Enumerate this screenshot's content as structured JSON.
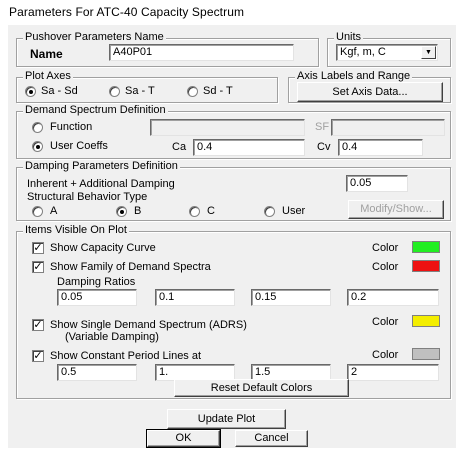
{
  "window_title": "Parameters For ATC-40 Capacity Spectrum",
  "pushover": {
    "legend": "Pushover Parameters Name",
    "name_label": "Name",
    "name_value": "A40P01"
  },
  "units": {
    "legend": "Units",
    "value": "Kgf, m, C"
  },
  "plot_axes": {
    "legend": "Plot Axes",
    "options": [
      "Sa - Sd",
      "Sa - T",
      "Sd - T"
    ],
    "selected": "Sa - Sd"
  },
  "axis_labels": {
    "legend": "Axis Labels and Range",
    "button": "Set Axis Data..."
  },
  "demand": {
    "legend": "Demand Spectrum Definition",
    "function_label": "Function",
    "user_coeffs_label": "User Coeffs",
    "sf_label": "SF",
    "ca_label": "Ca",
    "ca_value": "0.4",
    "cv_label": "Cv",
    "cv_value": "0.4",
    "selected": "User Coeffs"
  },
  "damping": {
    "legend": "Damping Parameters Definition",
    "inherent_label": "Inherent + Additional Damping",
    "inherent_value": "0.05",
    "behavior_label": "Structural Behavior Type",
    "types": [
      "A",
      "B",
      "C",
      "User"
    ],
    "selected": "B",
    "modify_button": "Modify/Show..."
  },
  "items": {
    "legend": "Items Visible On Plot",
    "color_label": "Color",
    "capacity_curve": {
      "label": "Show Capacity Curve",
      "checked": true,
      "color": "#22ee22"
    },
    "demand_family": {
      "label": "Show Family of Demand Spectra",
      "checked": true,
      "color": "#ee1111",
      "ratios_label": "Damping Ratios",
      "ratios": [
        "0.05",
        "0.1",
        "0.15",
        "0.2"
      ]
    },
    "single_demand": {
      "label": "Show Single  Demand Spectrum (ADRS)",
      "sublabel": "(Variable Damping)",
      "checked": true,
      "color": "#f4ee00"
    },
    "constant_period": {
      "label": "Show Constant Period Lines at",
      "checked": true,
      "color": "#c0c0c0",
      "values": [
        "0.5",
        "1.",
        "1.5",
        "2"
      ]
    },
    "reset_button": "Reset Default Colors"
  },
  "buttons": {
    "update": "Update Plot",
    "ok": "OK",
    "cancel": "Cancel"
  }
}
